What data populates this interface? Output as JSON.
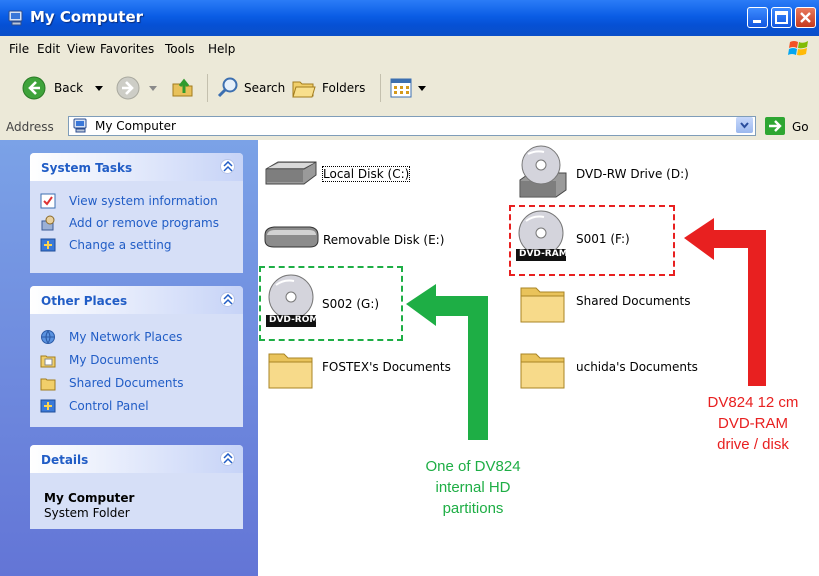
{
  "window": {
    "title": "My Computer"
  },
  "menu": [
    "File",
    "Edit",
    "View",
    "Favorites",
    "Tools",
    "Help"
  ],
  "toolbar": {
    "back_label": "Back",
    "search_label": "Search",
    "folders_label": "Folders"
  },
  "address": {
    "label": "Address",
    "value": "My Computer",
    "go_label": "Go"
  },
  "system_tasks": {
    "title": "System Tasks",
    "items": [
      "View system information",
      "Add or remove programs",
      "Change a setting"
    ]
  },
  "other_places": {
    "title": "Other Places",
    "items": [
      "My Network Places",
      "My Documents",
      "Shared Documents",
      "Control Panel"
    ]
  },
  "details": {
    "title": "Details",
    "name": "My Computer",
    "type": "System Folder"
  },
  "items": {
    "local_c": "Local Disk (C:)",
    "dvd_rw_d": "DVD-RW Drive (D:)",
    "removable_e": "Removable Disk (E:)",
    "s001_f": "S001 (F:)",
    "s002_g": "S002 (G:)",
    "shared_docs": "Shared Documents",
    "fostex_docs": "FOSTEX's Documents",
    "uchida_docs": "uchida's Documents"
  },
  "badges": {
    "dvd_ram": "DVD-RAM",
    "dvd_rom": "DVD-ROM"
  },
  "callouts": {
    "red": [
      "DV824 12 cm",
      "DVD-RAM",
      "drive / disk"
    ],
    "green": [
      "One of DV824",
      "internal HD",
      "partitions"
    ]
  },
  "colors": {
    "callout_red": "#e82020",
    "callout_green": "#1eae45",
    "xp_blue": "#0a5de5"
  }
}
